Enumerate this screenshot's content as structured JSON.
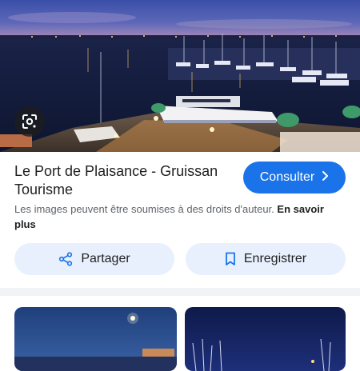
{
  "result": {
    "title": "Le Port de Plaisance - Gruissan Tourisme",
    "visit_label": "Consulter",
    "notice_text": "Les images peuvent être soumises à des droits d'auteur.",
    "notice_link": "En savoir plus"
  },
  "actions": {
    "share_label": "Partager",
    "save_label": "Enregistrer"
  },
  "colors": {
    "accent": "#1a73e8",
    "pill_background": "#e8f0fe"
  },
  "icons": {
    "lens": "google-lens-icon",
    "share": "share-icon",
    "save": "bookmark-icon",
    "chevron": "chevron-right-icon"
  }
}
